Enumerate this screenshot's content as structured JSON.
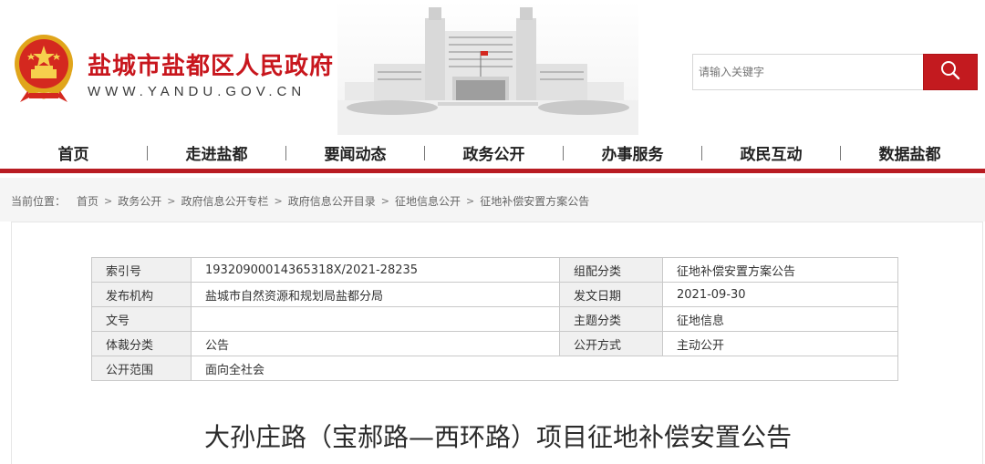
{
  "header": {
    "site_title": "盐城市盐都区人民政府",
    "site_url": "WWW.YANDU.GOV.CN",
    "emblem_icon": "national-emblem-icon",
    "search_placeholder": "请输入关键字",
    "search_icon": "search-icon",
    "accent_color": "#c31a1f"
  },
  "nav": {
    "items": [
      {
        "label": "首页"
      },
      {
        "label": "走进盐都"
      },
      {
        "label": "要闻动态"
      },
      {
        "label": "政务公开"
      },
      {
        "label": "办事服务"
      },
      {
        "label": "政民互动"
      },
      {
        "label": "数据盐都"
      }
    ]
  },
  "breadcrumb": {
    "label": "当前位置：",
    "items": [
      "首页",
      "政务公开",
      "政府信息公开专栏",
      "政府信息公开目录",
      "征地信息公开",
      "征地补偿安置方案公告"
    ],
    "separator": ">"
  },
  "meta": {
    "rows": [
      {
        "k1": "索引号",
        "v1": "19320900014365318X/2021-28235",
        "k2": "组配分类",
        "v2": "征地补偿安置方案公告"
      },
      {
        "k1": "发布机构",
        "v1": "盐城市自然资源和规划局盐都分局",
        "k2": "发文日期",
        "v2": "2021-09-30"
      },
      {
        "k1": "文号",
        "v1": "",
        "k2": "主题分类",
        "v2": "征地信息"
      },
      {
        "k1": "体裁分类",
        "v1": "公告",
        "k2": "公开方式",
        "v2": "主动公开"
      },
      {
        "k1": "公开范围",
        "v1": "面向全社会"
      }
    ]
  },
  "article": {
    "title": "大孙庄路（宝郝路—西环路）项目征地补偿安置公告"
  }
}
